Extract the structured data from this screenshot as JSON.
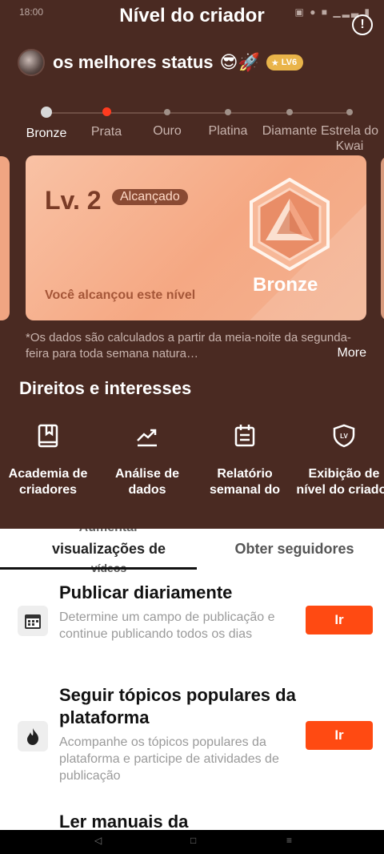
{
  "status_bar": {
    "time": "18:00",
    "icons": "● ✉ ✉ ■ ■ •",
    "right": "▣ ● ■ ▁▂▃ ▮"
  },
  "header": {
    "title": "Nível do criador",
    "info_icon": "info-icon"
  },
  "profile": {
    "name": "os melhores status",
    "emoji": "😎🚀",
    "level_badge": "LV6"
  },
  "levels": [
    {
      "label": "Bronze",
      "state": "current"
    },
    {
      "label": "Prata",
      "state": "active"
    },
    {
      "label": "Ouro",
      "state": "locked"
    },
    {
      "label": "Platina",
      "state": "locked"
    },
    {
      "label": "Diamante",
      "state": "locked"
    },
    {
      "label": "Estrela do Kwai",
      "state": "locked"
    }
  ],
  "card": {
    "level": "Lv. 2",
    "badge": "Alcançado",
    "subtitle": "Você alcançou este nível",
    "tier": "Bronze"
  },
  "note": {
    "text": "*Os dados são calculados a partir da meia-noite da segunda-feira para toda semana natura…",
    "more": "More"
  },
  "rights": {
    "title": "Direitos e interesses",
    "items": [
      {
        "label": "Academia de criadores",
        "icon": "book-icon"
      },
      {
        "label": "Análise de dados",
        "icon": "trend-chart-icon"
      },
      {
        "label": "Relatório semanal do criador",
        "icon": "calendar-report-icon"
      },
      {
        "label": "Exibição de nível do criador",
        "icon": "lv-shield-icon"
      }
    ]
  },
  "tabs": {
    "left_top": "Aumentar",
    "left": "visualizações de",
    "left_bottom": "vídeos",
    "right": "Obter seguidores"
  },
  "tasks": [
    {
      "title": "Publicar diariamente",
      "desc": "Determine um campo de publicação e continue publicando todos os dias",
      "button": "Ir",
      "icon": "calendar-icon"
    },
    {
      "title": "Seguir tópicos populares da plataforma",
      "desc": "Acompanhe os tópicos populares da plataforma e participe de atividades de publicação",
      "button": "Ir",
      "icon": "flame-icon"
    },
    {
      "title": "Ler manuais da",
      "desc": "",
      "button": "",
      "icon": ""
    }
  ],
  "navbar": {
    "back": "◁",
    "home": "□",
    "menu": "≡"
  }
}
